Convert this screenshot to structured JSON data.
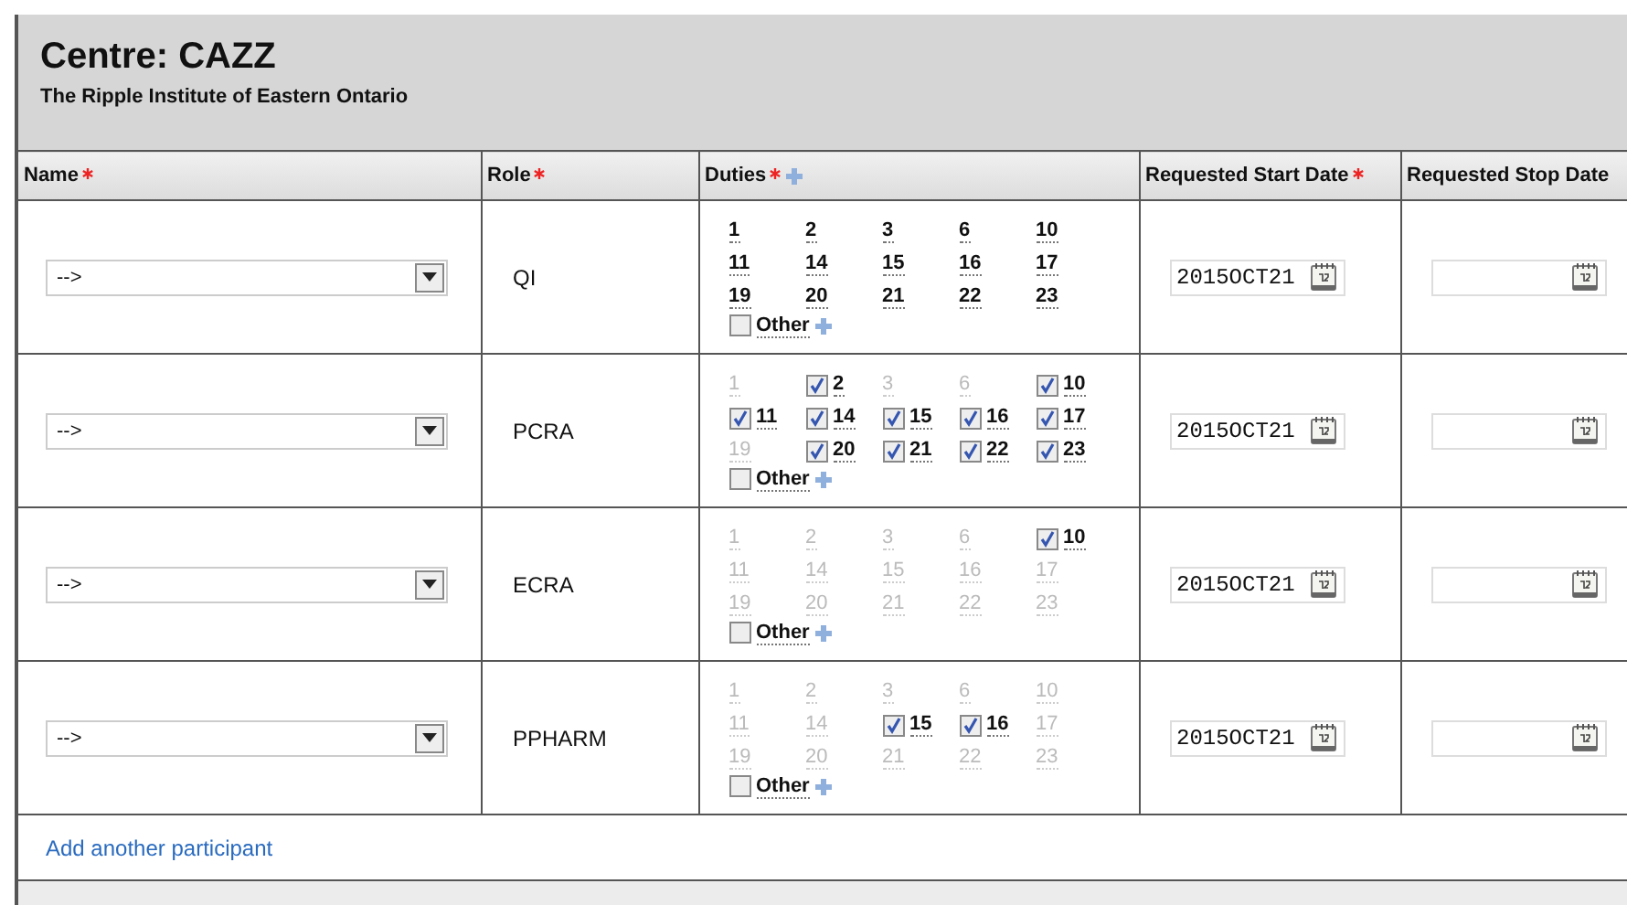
{
  "header": {
    "title": "Centre: CAZZ",
    "subtitle": "The Ripple Institute of Eastern Ontario"
  },
  "columns": [
    {
      "label": "Name",
      "required": true,
      "add_icon": false
    },
    {
      "label": "Role",
      "required": true,
      "add_icon": false
    },
    {
      "label": "Duties",
      "required": true,
      "add_icon": true
    },
    {
      "label": "Requested Start Date",
      "required": true,
      "add_icon": false
    },
    {
      "label": "Requested Stop Date",
      "required": false,
      "add_icon": false
    }
  ],
  "rows": [
    {
      "name": {
        "value": "-->"
      },
      "role": "QI",
      "duties": [
        {
          "label": "1",
          "kind": "plain"
        },
        {
          "label": "2",
          "kind": "plain"
        },
        {
          "label": "3",
          "kind": "plain"
        },
        {
          "label": "6",
          "kind": "plain"
        },
        {
          "label": "10",
          "kind": "plain"
        },
        {
          "label": "11",
          "kind": "plain"
        },
        {
          "label": "14",
          "kind": "plain"
        },
        {
          "label": "15",
          "kind": "plain"
        },
        {
          "label": "16",
          "kind": "plain"
        },
        {
          "label": "17",
          "kind": "plain"
        },
        {
          "label": "19",
          "kind": "plain"
        },
        {
          "label": "20",
          "kind": "plain"
        },
        {
          "label": "21",
          "kind": "plain"
        },
        {
          "label": "22",
          "kind": "plain"
        },
        {
          "label": "23",
          "kind": "plain"
        }
      ],
      "other": {
        "label": "Other",
        "checked": false
      },
      "start_date": "2015OCT21"
    },
    {
      "name": {
        "value": "-->"
      },
      "role": "PCRA",
      "duties": [
        {
          "label": "1",
          "kind": "greyed"
        },
        {
          "label": "2",
          "kind": "checkbox",
          "checked": true
        },
        {
          "label": "3",
          "kind": "greyed"
        },
        {
          "label": "6",
          "kind": "greyed"
        },
        {
          "label": "10",
          "kind": "checkbox",
          "checked": true
        },
        {
          "label": "11",
          "kind": "checkbox",
          "checked": true
        },
        {
          "label": "14",
          "kind": "checkbox",
          "checked": true
        },
        {
          "label": "15",
          "kind": "checkbox",
          "checked": true
        },
        {
          "label": "16",
          "kind": "checkbox",
          "checked": true
        },
        {
          "label": "17",
          "kind": "checkbox",
          "checked": true
        },
        {
          "label": "19",
          "kind": "greyed"
        },
        {
          "label": "20",
          "kind": "checkbox",
          "checked": true
        },
        {
          "label": "21",
          "kind": "checkbox",
          "checked": true
        },
        {
          "label": "22",
          "kind": "checkbox",
          "checked": true
        },
        {
          "label": "23",
          "kind": "checkbox",
          "checked": true
        }
      ],
      "other": {
        "label": "Other",
        "checked": false
      },
      "start_date": "2015OCT21"
    },
    {
      "name": {
        "value": "-->"
      },
      "role": "ECRA",
      "duties": [
        {
          "label": "1",
          "kind": "greyed"
        },
        {
          "label": "2",
          "kind": "greyed"
        },
        {
          "label": "3",
          "kind": "greyed"
        },
        {
          "label": "6",
          "kind": "greyed"
        },
        {
          "label": "10",
          "kind": "checkbox",
          "checked": true
        },
        {
          "label": "11",
          "kind": "greyed"
        },
        {
          "label": "14",
          "kind": "greyed"
        },
        {
          "label": "15",
          "kind": "greyed"
        },
        {
          "label": "16",
          "kind": "greyed"
        },
        {
          "label": "17",
          "kind": "greyed"
        },
        {
          "label": "19",
          "kind": "greyed"
        },
        {
          "label": "20",
          "kind": "greyed"
        },
        {
          "label": "21",
          "kind": "greyed"
        },
        {
          "label": "22",
          "kind": "greyed"
        },
        {
          "label": "23",
          "kind": "greyed"
        }
      ],
      "other": {
        "label": "Other",
        "checked": false
      },
      "start_date": "2015OCT21"
    },
    {
      "name": {
        "value": "-->"
      },
      "role": "PPHARM",
      "duties": [
        {
          "label": "1",
          "kind": "greyed"
        },
        {
          "label": "2",
          "kind": "greyed"
        },
        {
          "label": "3",
          "kind": "greyed"
        },
        {
          "label": "6",
          "kind": "greyed"
        },
        {
          "label": "10",
          "kind": "greyed"
        },
        {
          "label": "11",
          "kind": "greyed"
        },
        {
          "label": "14",
          "kind": "greyed"
        },
        {
          "label": "15",
          "kind": "checkbox",
          "checked": true
        },
        {
          "label": "16",
          "kind": "checkbox",
          "checked": true
        },
        {
          "label": "17",
          "kind": "greyed"
        },
        {
          "label": "19",
          "kind": "greyed"
        },
        {
          "label": "20",
          "kind": "greyed"
        },
        {
          "label": "21",
          "kind": "greyed"
        },
        {
          "label": "22",
          "kind": "greyed"
        },
        {
          "label": "23",
          "kind": "greyed"
        }
      ],
      "other": {
        "label": "Other",
        "checked": false
      },
      "start_date": "2015OCT21"
    }
  ],
  "add_link": "Add another participant"
}
